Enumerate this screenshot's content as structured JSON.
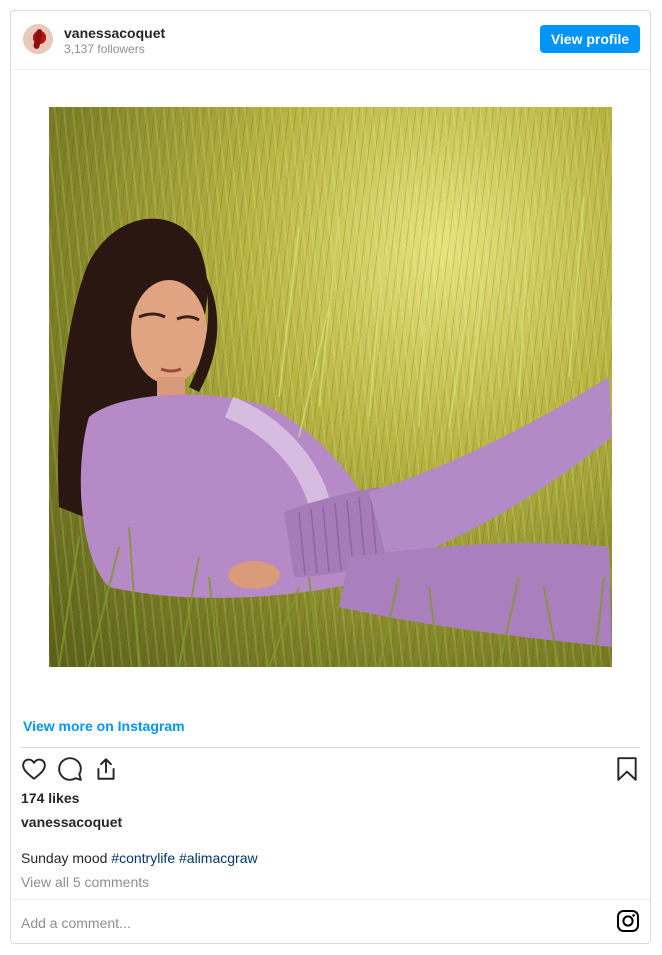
{
  "header": {
    "username": "vanessacoquet",
    "followers": "3,137 followers",
    "view_profile_label": "View profile"
  },
  "post": {
    "view_more_label": "View more on Instagram",
    "likes": "174 likes",
    "caption_user": "vanessacoquet",
    "caption_text": "Sunday mood",
    "hashtags": [
      "#contrylife",
      "#alimacgraw"
    ],
    "view_comments_label": "View all 5 comments",
    "comment_placeholder": "Add a comment..."
  },
  "icons": {
    "like": "heart-icon",
    "comment": "comment-bubble-icon",
    "share": "share-icon",
    "save": "bookmark-icon",
    "brand": "instagram-logo-icon"
  },
  "colors": {
    "accent": "#0095f6",
    "hashtag": "#00376b",
    "muted": "#8e8e8e",
    "text": "#262626",
    "border": "#dbdbdb"
  }
}
